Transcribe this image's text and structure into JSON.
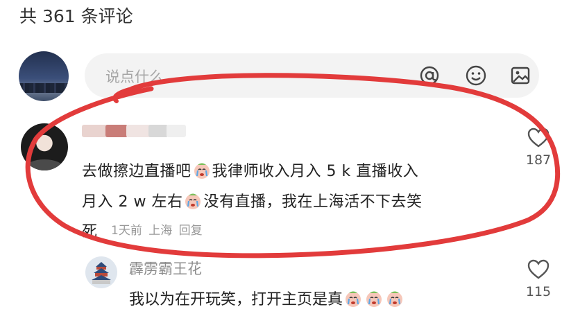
{
  "header": {
    "comment_count": "共 361 条评论"
  },
  "input": {
    "placeholder": "说点什么..."
  },
  "comment": {
    "line1a": "去做擦边直播吧",
    "line1b": "我律师收入月入 5 k 直播收入",
    "line2a": "月入 2 w 左右",
    "line2b": "没有直播，我在上海活不下去笑",
    "line3": "死",
    "time": "1天前",
    "location": "上海",
    "reply_label": "回复",
    "likes": "187",
    "emoji_icon": "crying-face-emoji"
  },
  "reply": {
    "author": "霹雳霸王花",
    "text": "我以为在开玩笑，打开主页是真",
    "likes": "115",
    "emoji_icon": "crying-face-emoji"
  },
  "colors": {
    "annotation": "#e23b3b",
    "meta_gray": "#999999",
    "input_bg": "#f3f3f3"
  }
}
